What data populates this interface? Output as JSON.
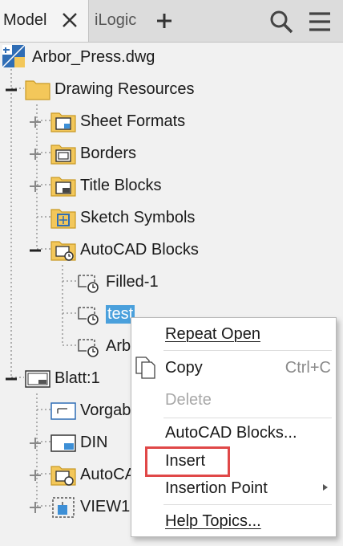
{
  "tabs": {
    "model": "Model",
    "ilogic": "iLogic"
  },
  "tree": {
    "root": "Arbor_Press.dwg",
    "drawing_resources": "Drawing Resources",
    "sheet_formats": "Sheet Formats",
    "borders": "Borders",
    "title_blocks": "Title Blocks",
    "sketch_symbols": "Sketch Symbols",
    "autocad_blocks": "AutoCAD Blocks",
    "filled_1": "Filled-1",
    "test": "test",
    "arb": "Arb",
    "blatt": "Blatt:1",
    "vorgab": "Vorgab",
    "din": "DIN",
    "autoca": "AutoCA",
    "view1": "VIEW1"
  },
  "menu": {
    "repeat_open": "Repeat Open",
    "copy": "Copy",
    "copy_shortcut": "Ctrl+C",
    "delete": "Delete",
    "autocad_blocks": "AutoCAD Blocks...",
    "insert": "Insert",
    "insertion_point": "Insertion Point",
    "help_topics": "Help Topics..."
  },
  "colors": {
    "selection": "#4aa0dc",
    "highlight": "#e04848",
    "folder": "#f3c75a"
  }
}
